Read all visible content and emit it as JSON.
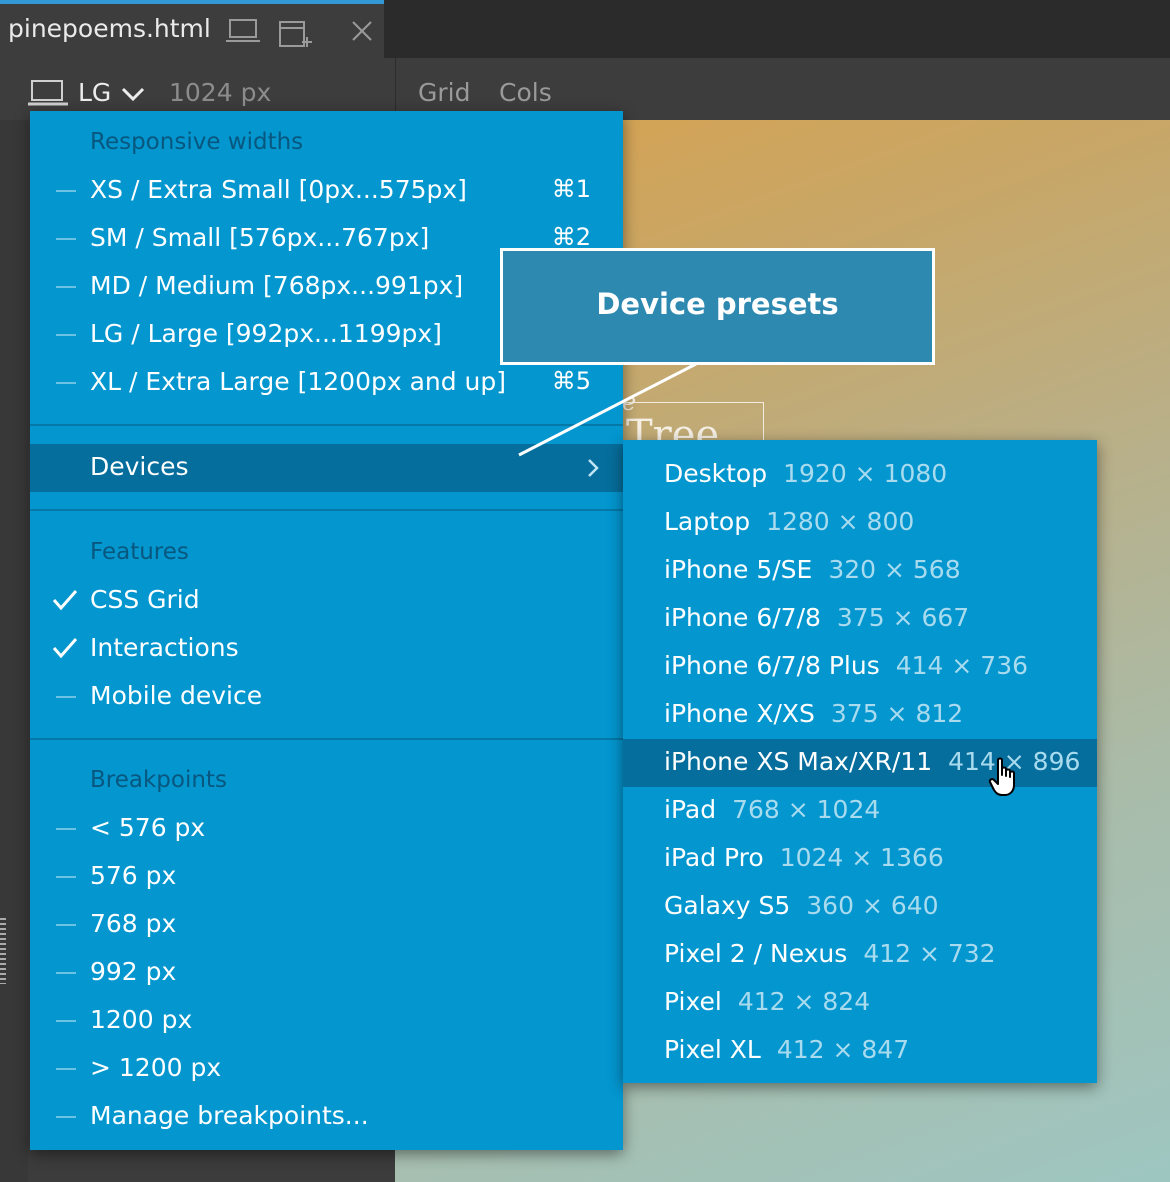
{
  "tab": {
    "title": "pinepoems.html"
  },
  "toolbar": {
    "device_label": "LG",
    "width_label": "1024 px",
    "grid_label": "Grid",
    "cols_label": "Cols"
  },
  "page_preview": {
    "title_fragment": "Tree",
    "script_fragment": "e"
  },
  "menu": {
    "responsive_title": "Responsive widths",
    "responsive_items": [
      {
        "label": "XS / Extra Small [0px...575px]",
        "shortcut": "⌘1"
      },
      {
        "label": "SM / Small [576px...767px]",
        "shortcut": "⌘2"
      },
      {
        "label": "MD / Medium [768px...991px]",
        "shortcut": ""
      },
      {
        "label": "LG / Large [992px...1199px]",
        "shortcut": ""
      },
      {
        "label": "XL / Extra Large [1200px and up]",
        "shortcut": "⌘5"
      }
    ],
    "devices_label": "Devices",
    "features_title": "Features",
    "features": [
      {
        "label": "CSS Grid",
        "checked": true
      },
      {
        "label": "Interactions",
        "checked": true
      },
      {
        "label": "Mobile device",
        "checked": false
      }
    ],
    "breakpoints_title": "Breakpoints",
    "breakpoints": [
      "< 576 px",
      "576 px",
      "768 px",
      "992 px",
      "1200 px",
      "> 1200 px",
      "Manage breakpoints..."
    ]
  },
  "devices": [
    {
      "name": "Desktop",
      "size": "1920 × 1080"
    },
    {
      "name": "Laptop",
      "size": "1280 × 800"
    },
    {
      "name": "iPhone 5/SE",
      "size": "320 × 568"
    },
    {
      "name": "iPhone 6/7/8",
      "size": "375 × 667"
    },
    {
      "name": "iPhone 6/7/8 Plus",
      "size": "414 × 736"
    },
    {
      "name": "iPhone X/XS",
      "size": "375 × 812"
    },
    {
      "name": "iPhone XS Max/XR/11",
      "size": "414 × 896",
      "selected": true
    },
    {
      "name": "iPad",
      "size": "768 × 1024"
    },
    {
      "name": "iPad Pro",
      "size": "1024 × 1366"
    },
    {
      "name": "Galaxy S5",
      "size": "360 × 640"
    },
    {
      "name": "Pixel 2 / Nexus",
      "size": "412 × 732"
    },
    {
      "name": "Pixel",
      "size": "412 × 824"
    },
    {
      "name": "Pixel XL",
      "size": "412 × 847"
    }
  ],
  "callout": {
    "text": "Device presets"
  },
  "colors": {
    "menu_bg": "#0396cf",
    "menu_highlight": "#066e9c",
    "submenu_highlight": "#066e9c",
    "callout_bg": "#2e89b1",
    "tab_accent": "#3399d6"
  }
}
